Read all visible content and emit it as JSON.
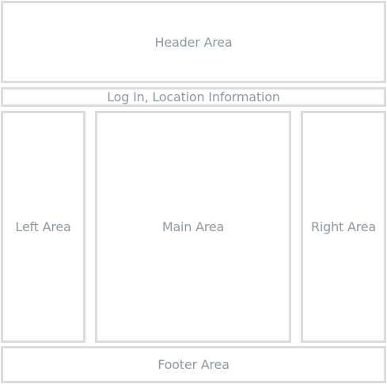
{
  "layout_diagram": {
    "header": {
      "label": "Header Area"
    },
    "login_bar": {
      "label": "Log In, Location Information"
    },
    "left": {
      "label": "Left Area"
    },
    "main": {
      "label": "Main Area"
    },
    "right": {
      "label": "Right Area"
    },
    "footer": {
      "label": "Footer Area"
    }
  },
  "colors": {
    "border": "#dcdcdc",
    "text": "#8e9aa3",
    "background": "#ffffff"
  }
}
